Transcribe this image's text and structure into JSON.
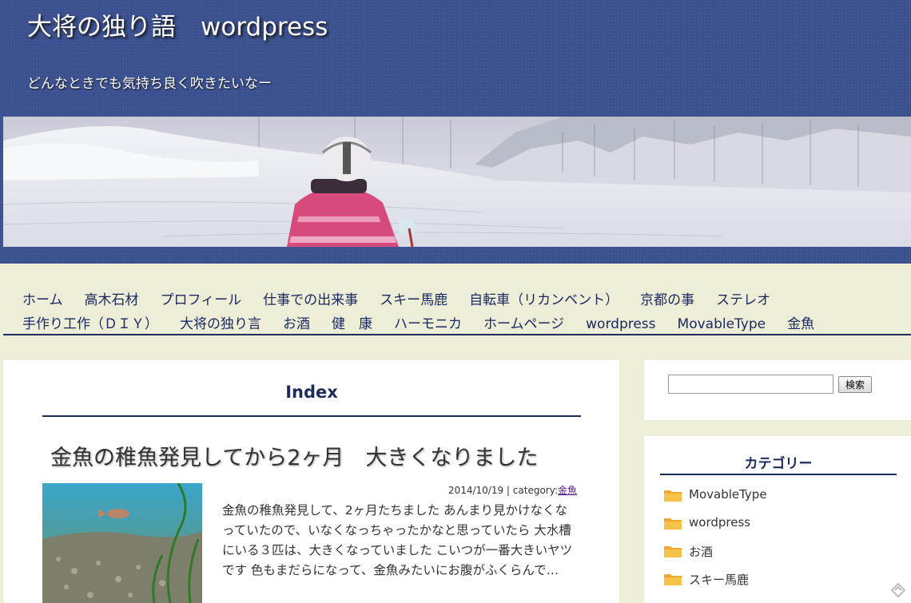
{
  "site": {
    "title": "大将の独り語　wordpress",
    "description": "どんなときでも気持ち良く吹きたいなー"
  },
  "nav": {
    "row1": [
      "ホーム",
      "高木石材",
      "プロフィール",
      "仕事での出来事",
      "スキー馬鹿",
      "自転車（リカンベント）",
      "京都の事",
      "ステレオ"
    ],
    "row2": [
      "手作り工作（ＤＩＹ）",
      "大将の独り言",
      "お酒",
      "健　康",
      "ハーモニカ",
      "ホームページ",
      "wordpress",
      "MovableType",
      "金魚"
    ]
  },
  "main": {
    "index_title": "Index",
    "post": {
      "title": "金魚の稚魚発見してから2ヶ月　大きくなりました",
      "date": "2014/10/19",
      "category_label": "category:",
      "category_link": "金魚",
      "excerpt": "金魚の稚魚発見して、2ヶ月たちました あんまり見かけなくなっていたので、いなくなっちゃったかなと思っていたら 大水槽にいる３匹は、大きくなっていました こいつが一番大きいヤツです 色もまだらになって、金魚みたいにお腹がふくらんで…"
    }
  },
  "sidebar": {
    "search_button": "検索",
    "category_title": "カテゴリー",
    "categories": [
      "MovableType",
      "wordpress",
      "お酒",
      "スキー馬鹿"
    ]
  },
  "colors": {
    "header_bg": "#3a5090",
    "page_bg": "#eeeed8",
    "accent_line": "#1b2b5a",
    "nav_text": "#1a2a60"
  }
}
